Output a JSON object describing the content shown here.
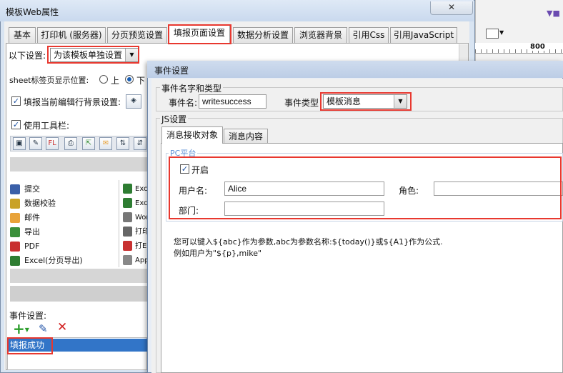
{
  "background_app": {
    "ruler_label": "800",
    "toolbar_icons": [
      "purple-arrow-icon",
      "dropdown-icon"
    ]
  },
  "main_window": {
    "title": "模板Web属性",
    "close_symbol": "✕",
    "tabs": [
      {
        "label": "基本"
      },
      {
        "label": "打印机 (服务器)"
      },
      {
        "label": "分页预览设置"
      },
      {
        "label": "填报页面设置"
      },
      {
        "label": "数据分析设置"
      },
      {
        "label": "浏览器背景"
      },
      {
        "label": "引用Css"
      },
      {
        "label": "引用JavaScript"
      }
    ],
    "settings_label": "以下设置:",
    "settings_combo_value": "为该模板单独设置",
    "sheet_tab_position_label": "sheet标签页显示位置:",
    "radio_top_label": "上",
    "radio_bottom_label": "下",
    "highlight_row_label": "填报当前编辑行背景设置:",
    "use_toolbar_label": "使用工具栏:",
    "toolbar_items_left": [
      {
        "icon": "save-icon",
        "label": "提交",
        "color": "#3a5fa8"
      },
      {
        "icon": "pencil-icon",
        "label": "数据校验",
        "color": "#c9a227"
      },
      {
        "icon": "mail-icon",
        "label": "邮件",
        "color": "#e8a33a"
      },
      {
        "icon": "export-icon",
        "label": "导出",
        "color": "#3a8f3a"
      },
      {
        "icon": "pdf-icon",
        "label": "PDF",
        "color": "#c83030"
      },
      {
        "icon": "excel-icon",
        "label": "Excel(分页导出)",
        "color": "#2e7d32"
      }
    ],
    "toolbar_items_right": [
      {
        "icon": "excel-icon",
        "label": "Exc",
        "color": "#2e7d32"
      },
      {
        "icon": "excel-icon",
        "label": "Exc",
        "color": "#2e7d32"
      },
      {
        "icon": "word-icon",
        "label": "Wor",
        "color": "#555555"
      },
      {
        "icon": "print-icon",
        "label": "打印",
        "color": "#555555"
      },
      {
        "icon": "flash-print-icon",
        "label": "打E",
        "color": "#c83030"
      },
      {
        "icon": "applet-icon",
        "label": "App",
        "color": "#555555"
      }
    ],
    "event_settings_label": "事件设置:",
    "event_list": [
      {
        "label": "填报成功"
      }
    ]
  },
  "dialog": {
    "title": "事件设置",
    "name_type_group": "事件名字和类型",
    "event_name_label": "事件名:",
    "event_name_value": "writesuccess",
    "event_type_label": "事件类型",
    "event_type_value": "模板消息",
    "js_group": "JS设置",
    "tabs": [
      {
        "label": "消息接收对象"
      },
      {
        "label": "消息内容"
      }
    ],
    "pc_group": "PC平台",
    "enable_label": "开启",
    "username_label": "用户名:",
    "username_value": "Alice",
    "role_label": "角色:",
    "role_value": "",
    "department_label": "部门:",
    "department_value": "",
    "help_line1": "您可以键入${abc}作为参数,abc为参数名称:${today()}或${A1}作为公式.",
    "help_line2": "例如用户为\"${p},mike\""
  },
  "colors": {
    "highlight_red": "#e8382f",
    "selection_blue": "#3275c8",
    "pc_group_text": "#5b8fd6",
    "add_green": "#2a9d2a",
    "delete_red": "#d22222"
  }
}
